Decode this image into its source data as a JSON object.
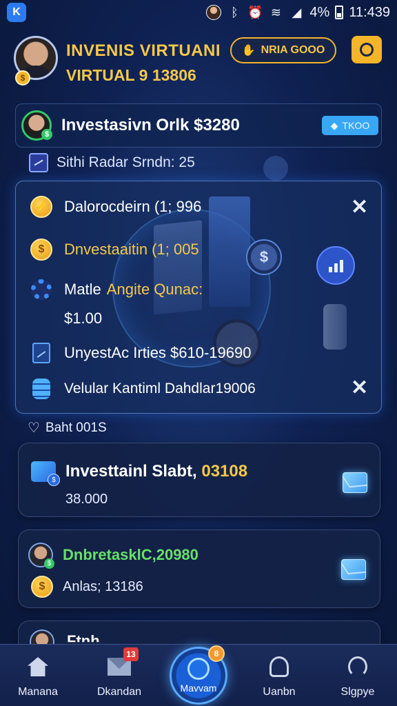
{
  "status_bar": {
    "app_badge": "K",
    "battery": "4%",
    "time": "11:439",
    "icons": [
      "avatar-icon",
      "bluetooth-icon",
      "alarm-icon",
      "wifi-icon",
      "signal-icon",
      "battery-icon"
    ]
  },
  "header": {
    "title": "INVENIS VIRTUANI",
    "subtitle": "VIRTUAL 9 13806",
    "pill_label": "NRIA GOOO",
    "icons": [
      "avatar-icon",
      "coin-icon",
      "hand-icon",
      "circle-icon"
    ]
  },
  "summary": {
    "title": "Investasivn Orlk $3280",
    "badge": "TKOO",
    "sub_line": "Sithi Radar Srndn: 25"
  },
  "panel": {
    "items": [
      {
        "text": "Dalorocdeirn (1; 996",
        "icon": "coin-icon"
      },
      {
        "text": "Dnvestaaitin (1; 005",
        "icon": "coin-icon"
      },
      {
        "text": "Matle",
        "highlight": "Angite Qunac:",
        "icon": "gear-icon"
      },
      {
        "text": "$1.00"
      },
      {
        "text": "UnyestAc Irties $610-19690",
        "icon": "document-icon"
      },
      {
        "text": "Velular Kantiml Dahdlar19006",
        "icon": "database-icon"
      }
    ],
    "coin_symbol": "$"
  },
  "section": {
    "label": "Baht 001S"
  },
  "cards": [
    {
      "title_white": "Investtainl Slabt, ",
      "title_yellow": "03108",
      "sub": "38.000"
    },
    {
      "title": "Dnbretaskl",
      "title_green": "C,20980",
      "sub": "Anlas; 13186"
    },
    {
      "title": "Ftnh...."
    }
  ],
  "bottom_nav": {
    "items": [
      {
        "label": "Manana",
        "icon": "home-icon"
      },
      {
        "label": "Dkandan",
        "icon": "mail-icon",
        "badge": "13"
      },
      {
        "label": "Mavvam",
        "icon": "center-icon",
        "badge": "8"
      },
      {
        "label": "Uanbn",
        "icon": "pin-icon"
      },
      {
        "label": "Slgpye",
        "icon": "user-icon"
      }
    ]
  },
  "colors": {
    "background": "#0f2152",
    "gold": "#f6c84a",
    "green": "#68e06a",
    "accent_blue": "#38a7f5"
  }
}
